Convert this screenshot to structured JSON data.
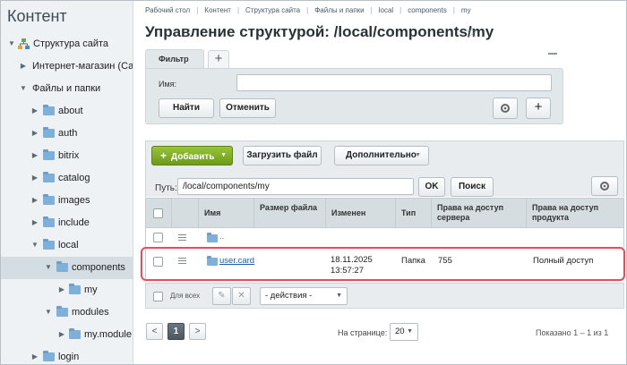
{
  "sidebar": {
    "title": "Контент",
    "items": [
      {
        "label": "Структура сайта"
      },
      {
        "label": "Интернет-магазин (Сайт по"
      },
      {
        "label": "Файлы и папки"
      },
      {
        "label": "about"
      },
      {
        "label": "auth"
      },
      {
        "label": "bitrix"
      },
      {
        "label": "catalog"
      },
      {
        "label": "images"
      },
      {
        "label": "include"
      },
      {
        "label": "local"
      },
      {
        "label": "components"
      },
      {
        "label": "my"
      },
      {
        "label": "modules"
      },
      {
        "label": "my.module"
      },
      {
        "label": "login"
      }
    ]
  },
  "breadcrumb": [
    "Рабочий стол",
    "Контент",
    "Структура сайта",
    "Файлы и папки",
    "local",
    "components",
    "my"
  ],
  "page_title": "Управление структурой: /local/components/my",
  "filter": {
    "tab_label": "Фильтр",
    "add_tab": "+",
    "name_label": "Имя:",
    "name_value": "",
    "find_button": "Найти",
    "reset_button": "Отменить",
    "add_button": "+"
  },
  "toolbar": {
    "add_button": "Добавить",
    "upload_button": "Загрузить файл",
    "more_button": "Дополнительно",
    "path_label": "Путь:",
    "path_value": "/local/components/my",
    "ok_button": "OK",
    "search_button": "Поиск"
  },
  "table": {
    "headers": [
      "Имя",
      "Размер файла",
      "Изменен",
      "Тип",
      "Права на доступ сервера",
      "Права на доступ продукта"
    ],
    "up_row_label": "..",
    "rows": [
      {
        "name": "user.card",
        "size": "",
        "modified_date": "18.11.2025",
        "modified_time": "13:57:27",
        "type": "Папка",
        "server_rights": "755",
        "product_rights": "Полный доступ"
      }
    ]
  },
  "actions": {
    "for_all_label": "Для всех",
    "actions_select": "- действия -"
  },
  "pager": {
    "prev": "<",
    "current_page": "1",
    "next": ">",
    "per_page_label": "На странице:",
    "per_page_value": "20",
    "shown_label": "Показано 1 – 1 из 1"
  }
}
